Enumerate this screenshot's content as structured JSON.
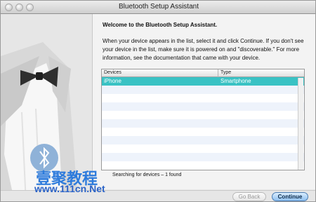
{
  "window": {
    "title": "Bluetooth Setup Assistant"
  },
  "content": {
    "heading": "Welcome to the Bluetooth Setup Assistant.",
    "description": "When your device appears in the list, select it and click Continue. If you don't see your device in the list, make sure it is powered on and \"discoverable.\" For more information, see the documentation that came with your device."
  },
  "table": {
    "columns": [
      "Devices",
      "Type"
    ],
    "rows": [
      {
        "device": "iPhone",
        "type": "Smartphone",
        "selected": true
      }
    ]
  },
  "status": {
    "text": "Searching for devices – 1 found"
  },
  "buttons": {
    "back": "Go Back",
    "continue": "Continue"
  },
  "watermark": {
    "chinese": "壹聚教程",
    "url": "www.111cn.Net"
  },
  "colors": {
    "selection": "#39c2c4",
    "watermark": "#2d7bdc"
  }
}
